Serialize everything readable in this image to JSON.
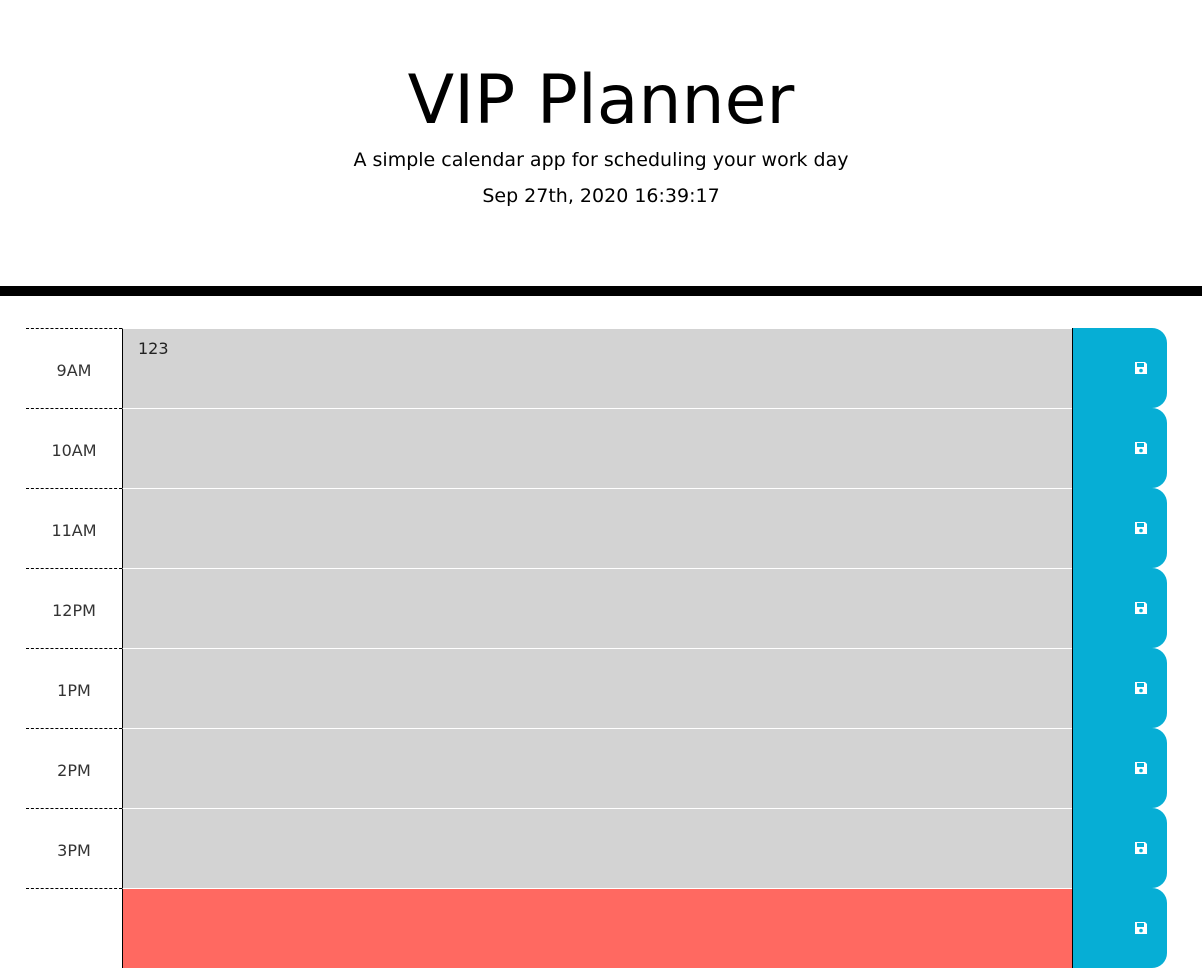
{
  "header": {
    "title": "VIP Planner",
    "subtitle": "A simple calendar app for scheduling your work day",
    "datetime": "Sep 27th, 2020 16:39:17"
  },
  "colors": {
    "past": "#d3d3d3",
    "present": "#ff6961",
    "save_button": "#06aed5"
  },
  "icons": {
    "save": "save-icon"
  },
  "hours": [
    {
      "label": "9AM",
      "text": "123",
      "state": "past"
    },
    {
      "label": "10AM",
      "text": "",
      "state": "past"
    },
    {
      "label": "11AM",
      "text": "",
      "state": "past"
    },
    {
      "label": "12PM",
      "text": "",
      "state": "past"
    },
    {
      "label": "1PM",
      "text": "",
      "state": "past"
    },
    {
      "label": "2PM",
      "text": "",
      "state": "past"
    },
    {
      "label": "3PM",
      "text": "",
      "state": "past"
    },
    {
      "label": "",
      "text": "",
      "state": "present"
    }
  ]
}
